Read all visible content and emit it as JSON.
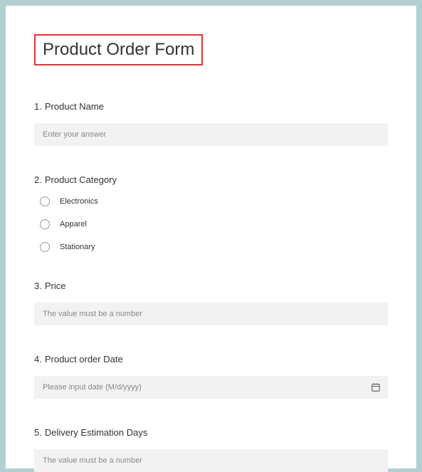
{
  "form": {
    "title": "Product Order Form",
    "questions": {
      "q1": {
        "num": "1.",
        "label": "Product Name",
        "placeholder": "Enter your answer"
      },
      "q2": {
        "num": "2.",
        "label": "Product Category",
        "options": [
          "Electronics",
          "Apparel",
          "Stationary"
        ]
      },
      "q3": {
        "num": "3.",
        "label": "Price",
        "placeholder": "The value must be a number"
      },
      "q4": {
        "num": "4.",
        "label": "Product order Date",
        "placeholder": "Please input date (M/d/yyyy)"
      },
      "q5": {
        "num": "5.",
        "label": "Delivery Estimation Days",
        "placeholder": "The value must be a number"
      }
    }
  }
}
